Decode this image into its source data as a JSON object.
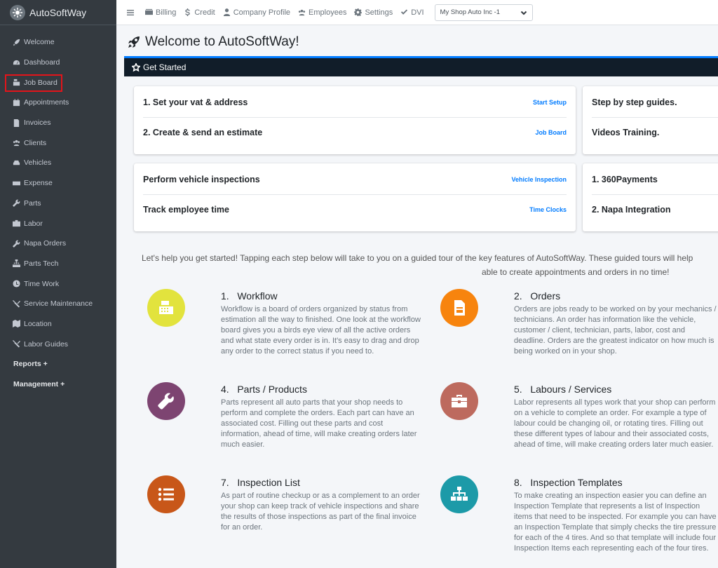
{
  "brand": {
    "name": "AutoSoftWay"
  },
  "sidebar": {
    "items": [
      {
        "label": "Welcome",
        "icon": "rocket-icon"
      },
      {
        "label": "Dashboard",
        "icon": "gauge-icon"
      },
      {
        "label": "Job Board",
        "icon": "cash-register-icon"
      },
      {
        "label": "Appointments",
        "icon": "calendar-check-icon"
      },
      {
        "label": "Invoices",
        "icon": "invoice-icon"
      },
      {
        "label": "Clients",
        "icon": "users-icon"
      },
      {
        "label": "Vehicles",
        "icon": "car-icon"
      },
      {
        "label": "Expense",
        "icon": "money-bill-icon"
      },
      {
        "label": "Parts",
        "icon": "wrench-icon"
      },
      {
        "label": "Labor",
        "icon": "toolbox-icon"
      },
      {
        "label": "Napa Orders",
        "icon": "wrench-icon"
      },
      {
        "label": "Parts Tech",
        "icon": "sitemap-icon"
      },
      {
        "label": "Time Work",
        "icon": "clock-icon"
      },
      {
        "label": "Service Maintenance",
        "icon": "tools-icon"
      },
      {
        "label": "Location",
        "icon": "map-icon"
      },
      {
        "label": "Labor Guides",
        "icon": "tools-icon"
      }
    ],
    "sections": [
      {
        "label": "Reports +"
      },
      {
        "label": "Management +"
      }
    ]
  },
  "topbar": {
    "links": [
      {
        "label": "Billing",
        "icon": "billing-icon"
      },
      {
        "label": "Credit",
        "icon": "dollar-icon"
      },
      {
        "label": "Company Profile",
        "icon": "user-icon"
      },
      {
        "label": "Employees",
        "icon": "users-icon"
      },
      {
        "label": "Settings",
        "icon": "gear-icon"
      },
      {
        "label": "DVI",
        "icon": "check-icon"
      }
    ],
    "shop_select": "My Shop Auto Inc -1"
  },
  "page": {
    "title": "Welcome to AutoSoftWay!",
    "get_started": "Get Started"
  },
  "cards": {
    "setup": [
      {
        "label": "1. Set your vat & address",
        "link": "Start Setup"
      },
      {
        "label": "2. Create & send an estimate",
        "link": "Job Board"
      }
    ],
    "guides": [
      {
        "label": "Step by step guides."
      },
      {
        "label": "Videos Training."
      }
    ],
    "inspections": [
      {
        "label": "Perform vehicle inspections",
        "link": "Vehicle Inspection"
      },
      {
        "label": "Track employee time",
        "link": "Time Clocks"
      }
    ],
    "integrations": [
      {
        "label": "1. 360Payments"
      },
      {
        "label": "2. Napa Integration"
      }
    ]
  },
  "intro": {
    "line1": "Let's help you get started! Tapping each step below will take to you on a guided tour of the key features of AutoSoftWay. These guided tours will help",
    "line2": "able to create appointments and orders in no time!"
  },
  "features": [
    {
      "title": "1.   Workflow",
      "icon": "cash-register-icon",
      "color": "#e2e33d",
      "desc": "Workflow is a board of orders organized by status from estimation all the way to finished. One look at the workflow board gives you a birds eye view of all the active orders and what state every order is in. It's easy to drag and drop any order to the correct status if you need to."
    },
    {
      "title": "2.   Orders",
      "icon": "document-icon",
      "color": "#f7840e",
      "desc": "Orders are jobs ready to be worked on by your mechanics / technicians. An order has information like the vehicle, customer / client, technician, parts, labor, cost and deadline. Orders are the greatest indicator on how much is being worked on in your shop."
    },
    {
      "title": "4.   Parts / Products",
      "icon": "wrench-icon",
      "color": "#7d4471",
      "desc": "Parts represent all auto parts that your shop needs to perform and complete the orders. Each part can have an associated cost. Filling out these parts and cost information, ahead of time, will make creating orders later much easier."
    },
    {
      "title": "5.   Labours / Services",
      "icon": "toolbox-icon",
      "color": "#bd6a5e",
      "desc": "Labor represents all types work that your shop can perform on a vehicle to complete an order. For example a type of labour could be changing oil, or rotating tires. Filling out these different types of labour and their associated costs, ahead of time, will make creating orders later much easier."
    },
    {
      "title": "7.   Inspection List",
      "icon": "list-icon",
      "color": "#c85719",
      "desc": "As part of routine checkup or as a complement to an order your shop can keep track of vehicle inspections and share the results of those inspections as part of the final invoice for an order."
    },
    {
      "title": "8.   Inspection Templates",
      "icon": "sitemap-icon",
      "color": "#1c9aa8",
      "desc": "To make creating an inspection easier you can define an Inspection Template that represents a list of Inspection items that need to be inspected. For example you can have an Inspection Template that simply checks the tire pressure for each of the 4 tires. And so that template will include four Inspection Items each representing each of the four tires."
    }
  ]
}
